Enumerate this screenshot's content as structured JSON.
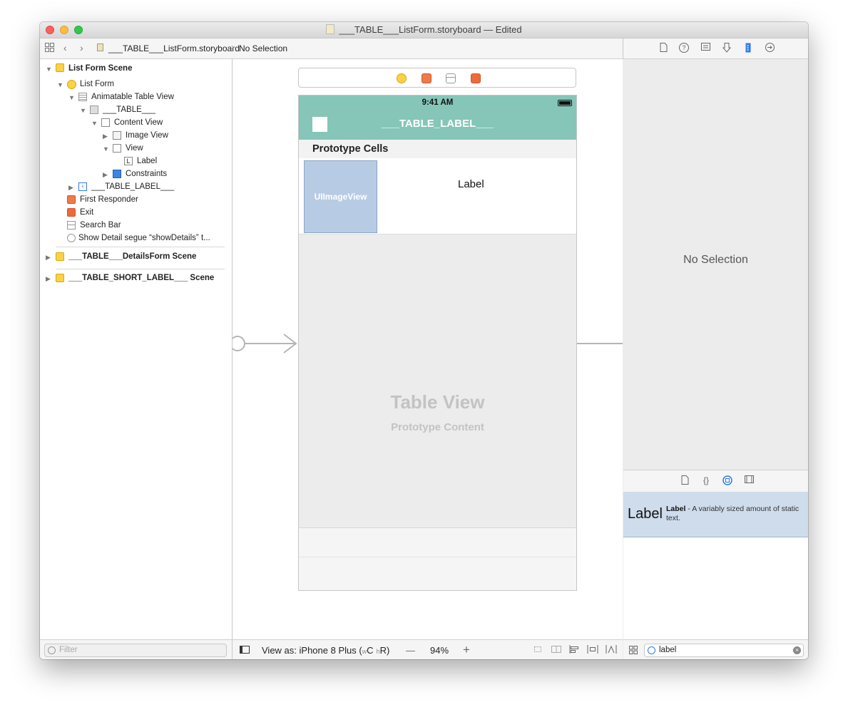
{
  "window": {
    "title": "___TABLE___ListForm.storyboard — Edited"
  },
  "pathbar": {
    "file": "___TABLE___ListForm.storyboard",
    "selection": "No Selection"
  },
  "navigator": {
    "scene1": "List Form Scene",
    "list_form": "List Form",
    "animatable_table_view": "Animatable Table View",
    "table_cell": "___TABLE___",
    "content_view": "Content View",
    "image_view": "Image View",
    "view": "View",
    "label": "Label",
    "constraints": "Constraints",
    "table_label": "___TABLE_LABEL___",
    "first_responder": "First Responder",
    "exit": "Exit",
    "search_bar": "Search Bar",
    "segue": "Show Detail segue “showDetails” t...",
    "scene2": "___TABLE___DetailsForm Scene",
    "scene3": "___TABLE_SHORT_LABEL___ Scene",
    "filter_placeholder": "Filter"
  },
  "phone": {
    "time": "9:41 AM",
    "nav_title": "___TABLE_LABEL___",
    "section_header": "Prototype Cells",
    "image_placeholder": "UIImageView",
    "cell_label": "Label",
    "table_title": "Table View",
    "table_subtitle": "Prototype Content"
  },
  "inspector": {
    "empty": "No Selection"
  },
  "library": {
    "item_big": "Label",
    "item_name": "Label",
    "item_desc": " - A variably sized amount of static text.",
    "search_value": "label"
  },
  "bottombar": {
    "view_as_prefix": "View as: iPhone 8 Plus (",
    "w_small": "w",
    "w_class": "C",
    "h_small": "h",
    "h_class": "R",
    "view_as_suffix": ")",
    "zoom": "94%",
    "minus": "—",
    "plus": "+"
  },
  "colors": {
    "nav_bar": "#85c6b8",
    "image_placeholder": "#b8cbe4",
    "library_selected": "#cedcec",
    "accent": "#2d7be5"
  }
}
